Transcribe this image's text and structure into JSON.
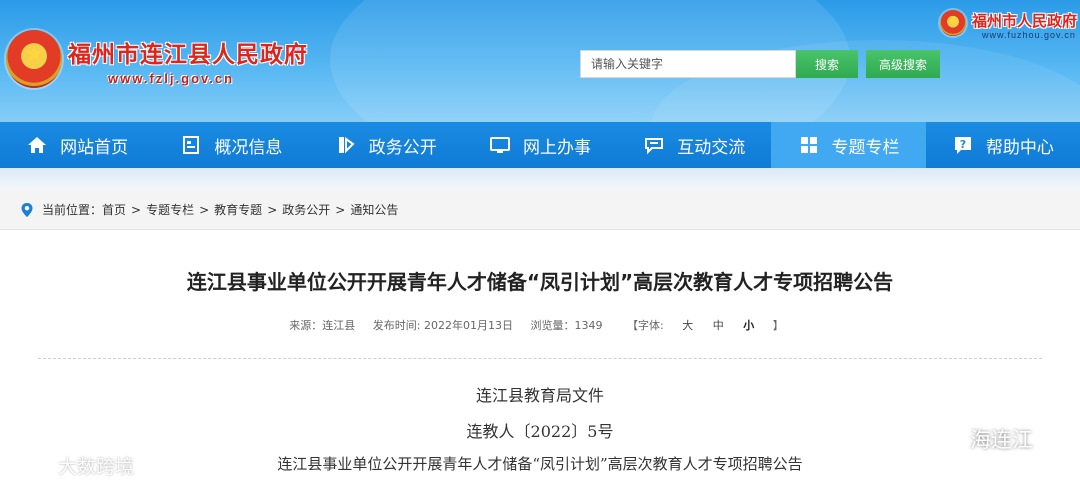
{
  "header": {
    "site_title": "福州市连江县人民政府",
    "site_url": "www.fzlj.gov.cn",
    "top_gov_name": "福州市人民政府",
    "top_gov_url": "www.fuzhou.gov.cn",
    "search_placeholder": "请输入关键字",
    "search_button": "搜索",
    "advanced_search_button": "高级搜索"
  },
  "nav": {
    "items": [
      {
        "label": "网站首页",
        "icon": "home-icon"
      },
      {
        "label": "概况信息",
        "icon": "document-icon"
      },
      {
        "label": "政务公开",
        "icon": "publish-icon"
      },
      {
        "label": "网上办事",
        "icon": "monitor-icon"
      },
      {
        "label": "互动交流",
        "icon": "chat-icon"
      },
      {
        "label": "专题专栏",
        "icon": "grid-icon"
      },
      {
        "label": "帮助中心",
        "icon": "help-icon"
      }
    ],
    "active_index": 5
  },
  "breadcrumb": {
    "prefix": "当前位置：",
    "items": [
      "首页",
      "专题专栏",
      "教育专题",
      "政务公开",
      "通知公告"
    ],
    "separator": ">"
  },
  "article": {
    "title": "连江县事业单位公开开展青年人才储备“凤引计划”高层次教育人才专项招聘公告",
    "source": "来源：连江县",
    "published": "发布时间: 2022年01月13日",
    "views": "浏览量：1349",
    "font_size_label": "【字体:",
    "font_sizes": [
      "大",
      "中",
      "小"
    ],
    "font_size_close": "】",
    "body_lines": [
      "连江县教育局文件",
      "连教人〔2022〕5号",
      "连江县事业单位公开开展青年人才储备“凤引计划”高层次教育人才专项招聘公告"
    ]
  },
  "watermarks": {
    "left": "大数跨境",
    "right": "海连江"
  },
  "colors": {
    "header_blue": "#2b9be8",
    "nav_blue": "#1a8be2",
    "nav_active": "#41a9f1",
    "button_green": "#2faa50",
    "title_red": "#e0241c"
  }
}
